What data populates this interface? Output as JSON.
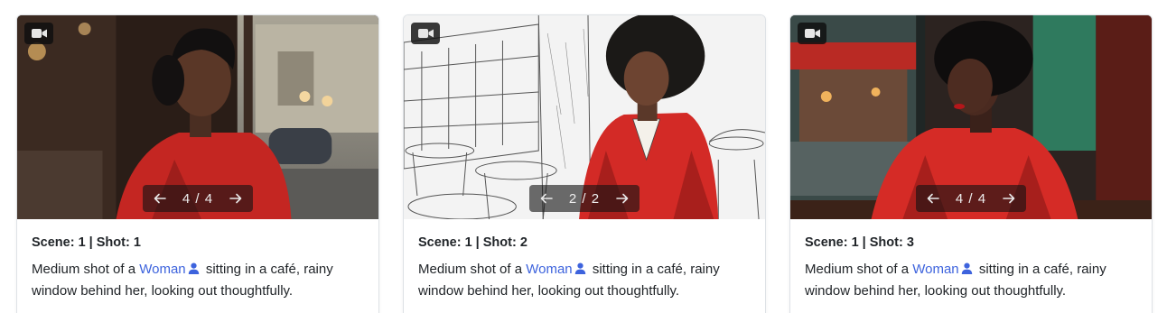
{
  "cards": [
    {
      "title": "Scene: 1 | Shot: 1",
      "pager": {
        "current": 4,
        "total": 4,
        "label": "4 / 4"
      },
      "description": {
        "prefix": "Medium shot of a ",
        "character": "Woman",
        "suffix": " sitting in a café, rainy window behind her, looking out thoughtfully."
      }
    },
    {
      "title": "Scene: 1 | Shot: 2",
      "pager": {
        "current": 2,
        "total": 2,
        "label": "2 / 2"
      },
      "description": {
        "prefix": "Medium shot of a ",
        "character": "Woman",
        "suffix": " sitting in a café, rainy window behind her, looking out thoughtfully."
      }
    },
    {
      "title": "Scene: 1 | Shot: 3",
      "pager": {
        "current": 4,
        "total": 4,
        "label": "4 / 4"
      },
      "description": {
        "prefix": "Medium shot of a ",
        "character": "Woman",
        "suffix": " sitting in a café, rainy window behind her, looking out thoughtfully."
      }
    }
  ],
  "icons": {
    "media_type": "video-camera-icon",
    "prev": "arrow-left-icon",
    "next": "arrow-right-icon",
    "character": "person-icon"
  },
  "colors": {
    "link": "#3d63dd",
    "coat_red": "#d42a25",
    "card_border": "#dee2e6"
  }
}
